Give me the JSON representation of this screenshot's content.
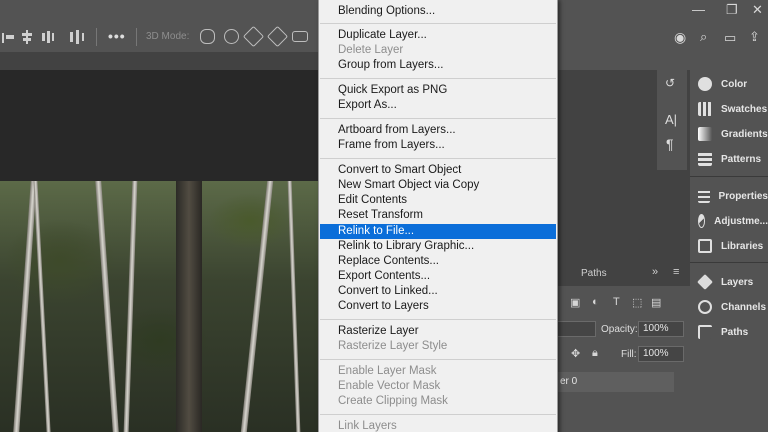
{
  "options_bar": {
    "mode_3d_label": "3D Mode:",
    "more_label": "•••"
  },
  "panels": {
    "narrow": [
      {
        "icon": "history-icon"
      },
      {
        "icon": "character-icon",
        "glyph": "A|"
      },
      {
        "icon": "paragraph-icon",
        "glyph": "¶"
      }
    ],
    "items": [
      {
        "label": "Color",
        "icon": "color-icon"
      },
      {
        "label": "Swatches",
        "icon": "swatches-icon"
      },
      {
        "label": "Gradients",
        "icon": "gradients-icon"
      },
      {
        "label": "Patterns",
        "icon": "patterns-icon"
      },
      {
        "label": "Properties",
        "icon": "properties-icon"
      },
      {
        "label": "Adjustme...",
        "icon": "adjustments-icon"
      },
      {
        "label": "Libraries",
        "icon": "libraries-icon"
      },
      {
        "label": "Layers",
        "icon": "layers-icon"
      },
      {
        "label": "Channels",
        "icon": "channels-icon"
      },
      {
        "label": "Paths",
        "icon": "paths-icon"
      }
    ]
  },
  "layers_panel": {
    "tab_paths": "Paths",
    "collapse_glyph": "»",
    "menu_glyph": "≡",
    "opacity_label": "Opacity:",
    "opacity_value": "100%",
    "fill_label": "Fill:",
    "fill_value": "100%",
    "layer_name": "er 0"
  },
  "context_menu": {
    "highlight_color": "#0b6ed9",
    "items": [
      {
        "label": "Blending Options...",
        "enabled": true
      },
      {
        "label": "Duplicate Layer...",
        "enabled": true
      },
      {
        "label": "Delete Layer",
        "enabled": false
      },
      {
        "label": "Group from Layers...",
        "enabled": true
      },
      {
        "label": "Quick Export as PNG",
        "enabled": true
      },
      {
        "label": "Export As...",
        "enabled": true
      },
      {
        "label": "Artboard from Layers...",
        "enabled": true
      },
      {
        "label": "Frame from Layers...",
        "enabled": true
      },
      {
        "label": "Convert to Smart Object",
        "enabled": true
      },
      {
        "label": "New Smart Object via Copy",
        "enabled": true
      },
      {
        "label": "Edit Contents",
        "enabled": true
      },
      {
        "label": "Reset Transform",
        "enabled": true
      },
      {
        "label": "Relink to File...",
        "enabled": true,
        "highlighted": true
      },
      {
        "label": "Relink to Library Graphic...",
        "enabled": true
      },
      {
        "label": "Replace Contents...",
        "enabled": true
      },
      {
        "label": "Export Contents...",
        "enabled": true
      },
      {
        "label": "Convert to Linked...",
        "enabled": true
      },
      {
        "label": "Convert to Layers",
        "enabled": true
      },
      {
        "label": "Rasterize Layer",
        "enabled": true
      },
      {
        "label": "Rasterize Layer Style",
        "enabled": false
      },
      {
        "label": "Enable Layer Mask",
        "enabled": false
      },
      {
        "label": "Enable Vector Mask",
        "enabled": false
      },
      {
        "label": "Create Clipping Mask",
        "enabled": false
      },
      {
        "label": "Link Layers",
        "enabled": false
      }
    ]
  }
}
